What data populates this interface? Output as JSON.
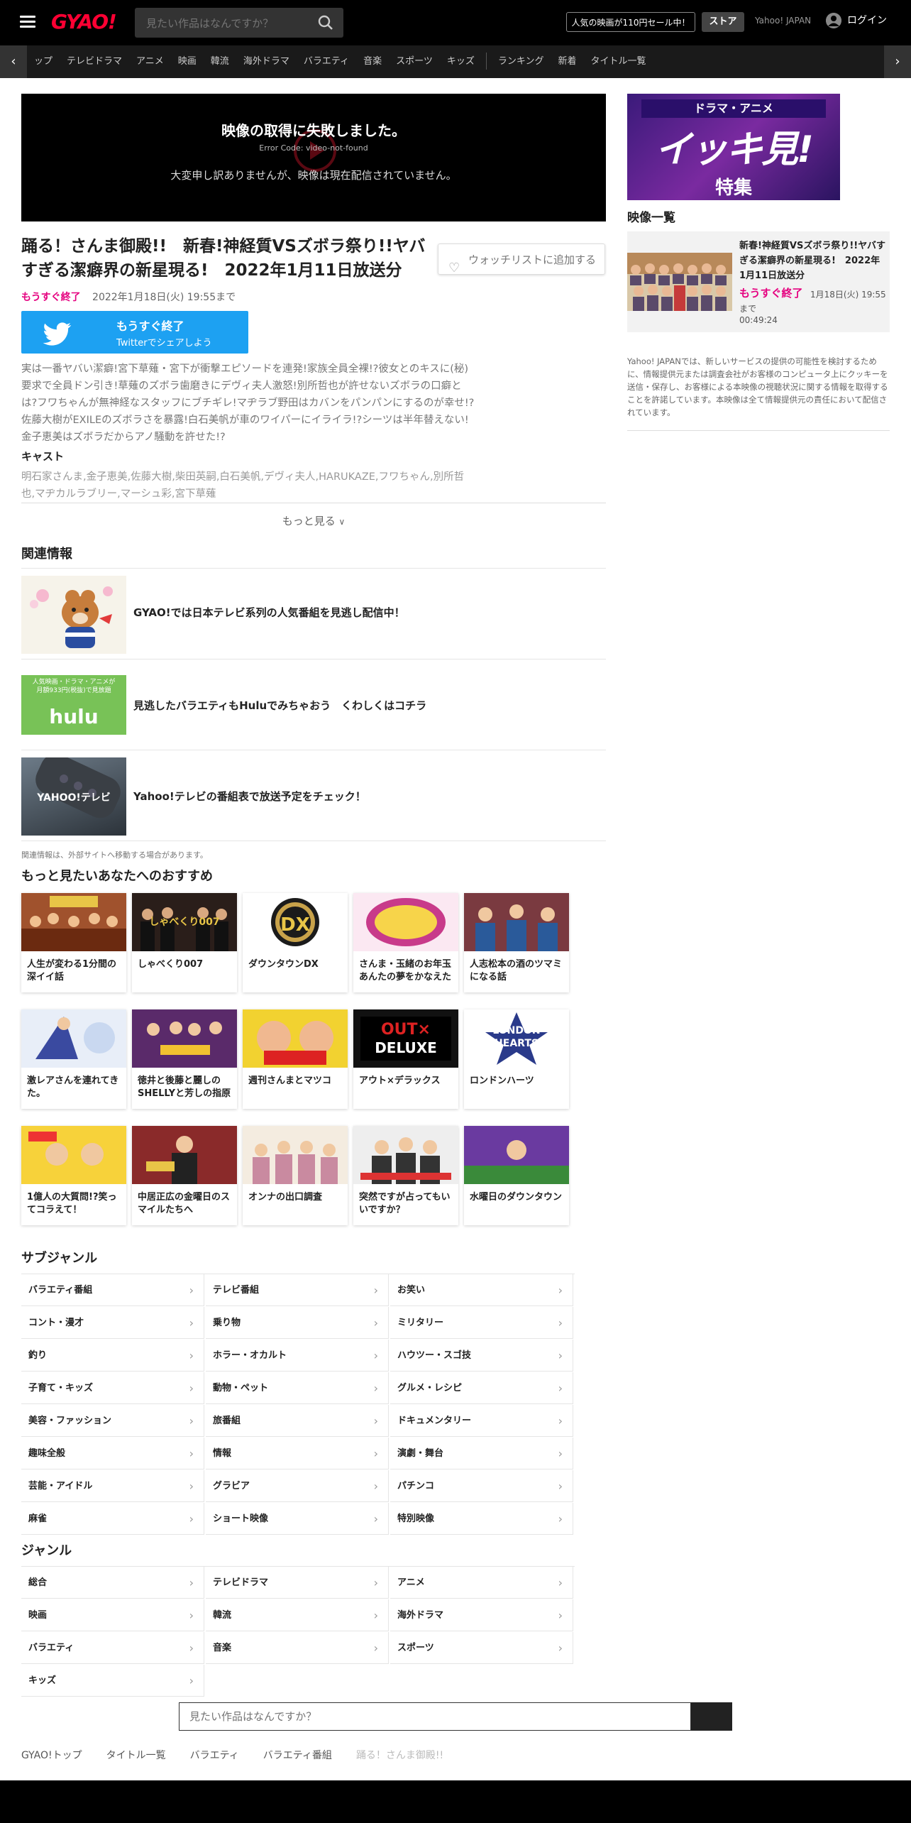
{
  "header": {
    "logo": "GYAO!",
    "search_placeholder": "見たい作品はなんですか？",
    "sale_label": "人気の映画が110円セール中！",
    "store_label": "ストア",
    "yahoo_link": "Yahoo! JAPAN",
    "login_label": "ログイン"
  },
  "nav": {
    "items": [
      "ップ",
      "テレビドラマ",
      "アニメ",
      "映画",
      "韓流",
      "海外ドラマ",
      "バラエティ",
      "音楽",
      "スポーツ",
      "キッズ"
    ],
    "extra_items": [
      "ランキング",
      "新着",
      "タイトル一覧"
    ]
  },
  "player": {
    "error_title": "映像の取得に失敗しました。",
    "error_code": "Error Code: video-not-found",
    "error_message": "大変申し訳ありませんが、映像は現在配信されていません。"
  },
  "program": {
    "title": "踊る！さんま御殿!!　新春!神経質VSズボラ祭り!!ヤバすぎる潔癖界の新星現る!　2022年1月11日放送分",
    "watchlist_label": "ウォッチリストに追加する",
    "status": "もうすぐ終了",
    "end_date": "2022年1月18日(火) 19:55まで",
    "twitter_line1": "もうすぐ終了",
    "twitter_line2": "Twitterでシェアしよう",
    "description": "実は一番ヤバい潔癖!宮下草薙・宮下が衝撃エピソードを連発!家族全員全裸!?彼女とのキスに(秘)要求で全員ドン引き!草薙のズボラ歯磨きにデヴィ夫人激怒!別所哲也が許せないズボラの口癖とは?フワちゃんが無神経なスタッフにブチギレ!マヂラブ野田はカバンをパンパンにするのが幸せ!?佐藤大樹がEXILEのズボラさを暴露!白石美帆が車のワイパーにイライラ!?シーツは半年替えない!金子恵美はズボラだからアノ騒動を許せた!?",
    "cast_heading": "キャスト",
    "cast": "明石家さんま,金子恵美,佐藤大樹,柴田英嗣,白石美帆,デヴィ夫人,HARUKAZE,フワちゃん,別所哲也,マヂカルラブリー,マーシュ彩,宮下草薙",
    "more_label": "もっと見る"
  },
  "related": {
    "heading": "関連情報",
    "items": [
      {
        "text": "GYAO!では日本テレビ系列の人気番組を見逃し配信中！"
      },
      {
        "text": "見逃したバラエティもHuluでみちゃおう　くわしくはコチラ",
        "thumb_text1": "人気映画・ドラマ・アニメが",
        "thumb_text2": "月額933円(税抜)で見放題",
        "thumb_logo": "hulu"
      },
      {
        "text": "Yahoo!テレビの番組表で放送予定をチェック！",
        "thumb_logo": "YAHOO!テレビ"
      }
    ],
    "note": "関連情報は、外部サイトへ移動する場合があります。"
  },
  "recommend": {
    "heading": "もっと見たいあなたへのおすすめ",
    "items": [
      {
        "title": "人生が変わる1分間の深イイ話"
      },
      {
        "title": "しゃべくり007",
        "thumb_text": "しゃべくり007"
      },
      {
        "title": "ダウンタウンDX",
        "thumb_text": "DX"
      },
      {
        "title": "さんま・玉緒のお年玉あんたの夢をかなえたろかSP"
      },
      {
        "title": "人志松本の酒のツマミになる話"
      },
      {
        "title": "激レアさんを連れてきた。"
      },
      {
        "title": "徳井と後藤と麗しのSHELLYと芳しの指原が今夜くらべてみました"
      },
      {
        "title": "週刊さんまとマツコ"
      },
      {
        "title": "アウト×デラックス",
        "thumb_text1": "OUT×",
        "thumb_text2": "DELUXE"
      },
      {
        "title": "ロンドンハーツ",
        "thumb_text1": "LONDON",
        "thumb_text2": "HEARTS"
      },
      {
        "title": "1億人の大質問!?笑ってコラえて！"
      },
      {
        "title": "中居正広の金曜日のスマイルたちへ"
      },
      {
        "title": "オンナの出口調査"
      },
      {
        "title": "突然ですが占ってもいいですか？"
      },
      {
        "title": "水曜日のダウンタウン"
      }
    ]
  },
  "subgenre": {
    "heading": "サブジャンル",
    "items": [
      "バラエティ番組",
      "テレビ番組",
      "お笑い",
      "コント・漫才",
      "乗り物",
      "ミリタリー",
      "釣り",
      "ホラー・オカルト",
      "ハウツー・スゴ技",
      "子育て・キッズ",
      "動物・ペット",
      "グルメ・レシピ",
      "美容・ファッション",
      "旅番組",
      "ドキュメンタリー",
      "趣味全般",
      "情報",
      "演劇・舞台",
      "芸能・アイドル",
      "グラビア",
      "パチンコ",
      "麻雀",
      "ショート映像",
      "特別映像"
    ]
  },
  "genre": {
    "heading": "ジャンル",
    "items": [
      "総合",
      "テレビドラマ",
      "アニメ",
      "映画",
      "韓流",
      "海外ドラマ",
      "バラエティ",
      "音楽",
      "スポーツ",
      "キッズ"
    ]
  },
  "bottom_search": {
    "placeholder": "見たい作品はなんですか？"
  },
  "breadcrumb": [
    "GYAO!トップ",
    "タイトル一覧",
    "バラエティ",
    "バラエティ番組",
    "踊る！さんま御殿!!"
  ],
  "sidebar": {
    "banner_top": "ドラマ・アニメ",
    "banner_big": "イッキ見!",
    "banner_sub": "特集",
    "video_list_heading": "映像一覧",
    "video": {
      "title": "新春!神経質VSズボラ祭り!!ヤバすぎる潔癖界の新星現る!　2022年1月11日放送分",
      "status": "もうすぐ終了",
      "date": "1月18日(火) 19:55",
      "until": "まで",
      "duration": "00:49:24"
    },
    "note": "Yahoo! JAPANでは、新しいサービスの提供の可能性を検討するために、情報提供元または調査会社がお客様のコンピュータ上にクッキーを送信・保存し、お客様による本映像の視聴状況に関する情報を取得することを許諾しています。本映像は全て情報提供元の責任において配信されています。"
  },
  "colors": {
    "accent": "#ff0033",
    "ending": "#e5007f",
    "twitter": "#1da1f2"
  }
}
